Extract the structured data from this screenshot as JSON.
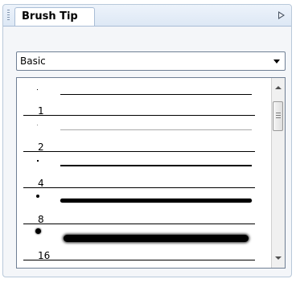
{
  "panel": {
    "tab_label": "Brush Tip",
    "menu_icon": "flyout-arrow-icon"
  },
  "preset_select": {
    "value": "Basic"
  },
  "brushes": [
    {
      "size": "1"
    },
    {
      "size": "2"
    },
    {
      "size": "4"
    },
    {
      "size": "8"
    },
    {
      "size": "16"
    }
  ],
  "colors": {
    "panel_border": "#b9c9da",
    "tab_strip": "#dde8f5",
    "list_border": "#6f7f94"
  }
}
